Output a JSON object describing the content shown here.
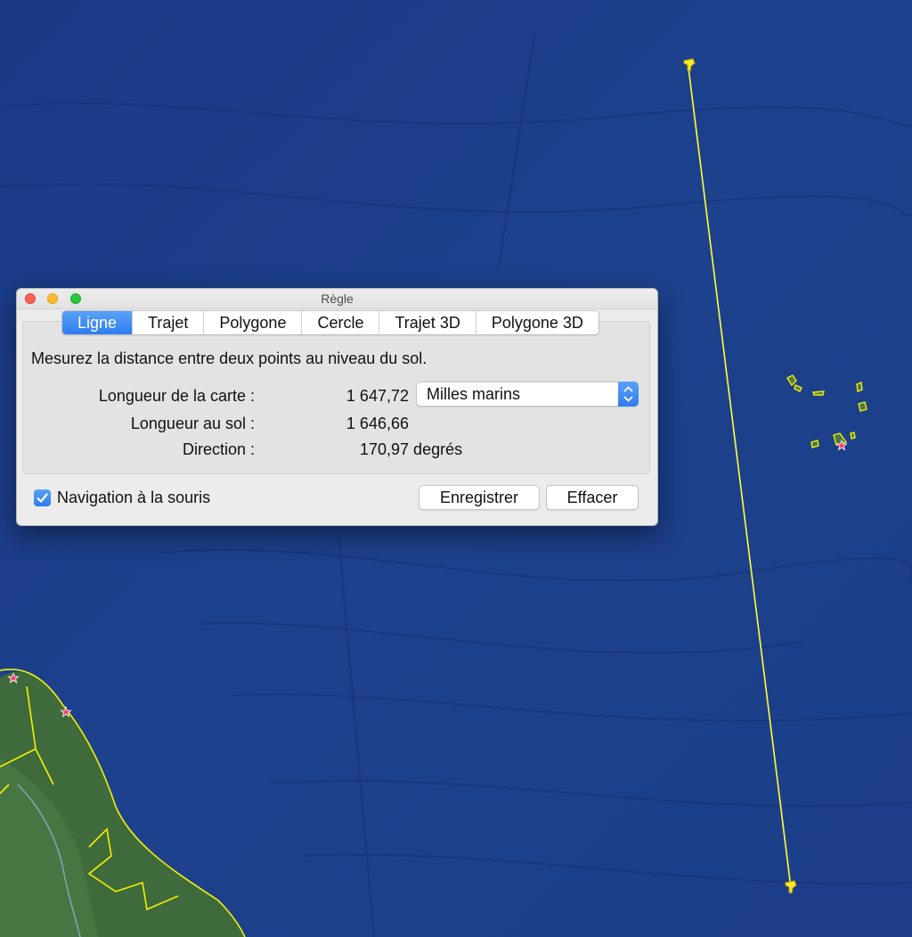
{
  "window": {
    "title": "Règle",
    "tabs": [
      {
        "label": "Ligne",
        "active": true
      },
      {
        "label": "Trajet",
        "active": false
      },
      {
        "label": "Polygone",
        "active": false
      },
      {
        "label": "Cercle",
        "active": false
      },
      {
        "label": "Trajet 3D",
        "active": false
      },
      {
        "label": "Polygone 3D",
        "active": false
      }
    ],
    "description": "Mesurez la distance entre deux points au niveau du sol.",
    "map_length": {
      "label": "Longueur de la carte :",
      "value": "1 647,72"
    },
    "ground_length": {
      "label": "Longueur au sol :",
      "value": "1 646,66"
    },
    "direction": {
      "label": "Direction :",
      "value": "170,97 degrés"
    },
    "unit_select": {
      "value": "Milles marins"
    },
    "mouse_navigation": {
      "label": "Navigation à la souris",
      "checked": true
    },
    "save_button": "Enregistrer",
    "clear_button": "Effacer"
  },
  "colors": {
    "ocean": "#1c3f86",
    "measure_line": "#ffff33",
    "accent": "#2f7df1",
    "land": "#3f6b3c",
    "borders": "#f2f200"
  },
  "icons": [
    "pushpin-icon",
    "chevron-updown-icon",
    "checkmark-icon",
    "star-icon"
  ]
}
